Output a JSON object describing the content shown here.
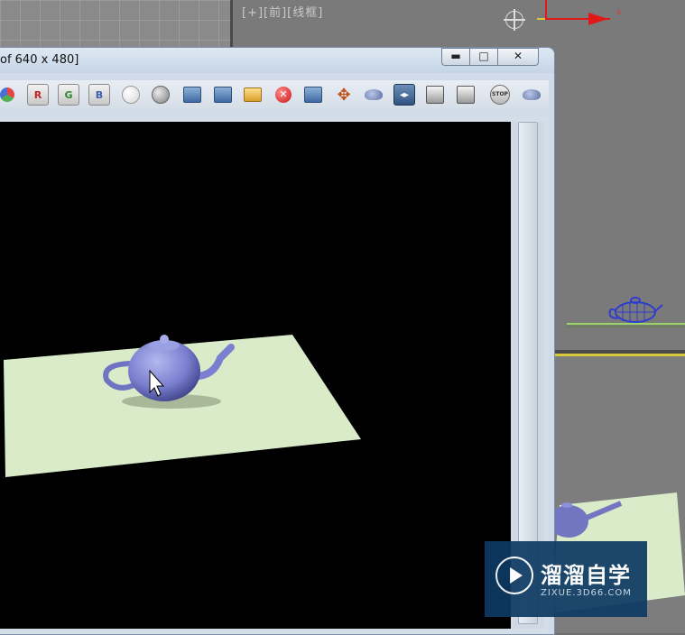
{
  "background_viewport": {
    "label": "[+][前][线框]"
  },
  "gizmo": {
    "axis_x_label": "x",
    "colors": {
      "x_axis": "#e01818",
      "y_axis": "#e01818",
      "z_highlight": "#d8c93a"
    }
  },
  "render_window": {
    "title": "of 640 x 480]",
    "buttons": {
      "minimize_label": "▬",
      "maximize_label": "□",
      "close_label": "✕"
    },
    "toolbar": {
      "channel_red": "R",
      "channel_green": "G",
      "channel_blue": "B",
      "stop_label": "STOP",
      "icons": [
        "enable-channels-icon",
        "red-channel-icon",
        "green-channel-icon",
        "blue-channel-icon",
        "white-sphere-icon",
        "grey-sphere-icon",
        "save-image-icon",
        "clone-window-icon",
        "open-folder-icon",
        "clear-icon",
        "copy-image-icon",
        "track-icon",
        "render-teapot-icon",
        "toggle-ui-icon",
        "display-left-icon",
        "display-right-icon",
        "stop-render-icon",
        "teapot-render-icon"
      ]
    },
    "scene": {
      "background_color": "#000000",
      "plane_color": "#d9ebc8",
      "teapot_color": "#7a7fcf"
    }
  },
  "watermark": {
    "name": "溜溜自学",
    "url": "ZIXUE.3D66.COM"
  }
}
